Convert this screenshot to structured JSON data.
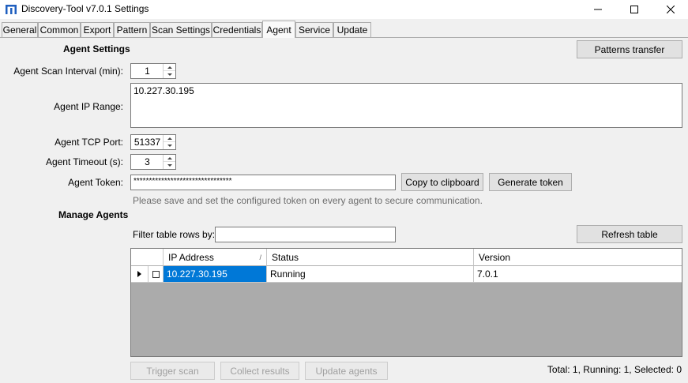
{
  "window": {
    "title": "Discovery-Tool v7.0.1 Settings",
    "minimize_glyph": "—",
    "maximize_glyph": "☐",
    "close_glyph": "✕"
  },
  "tabs": [
    {
      "label": "General"
    },
    {
      "label": "Common"
    },
    {
      "label": "Export"
    },
    {
      "label": "Pattern"
    },
    {
      "label": "Scan Settings"
    },
    {
      "label": "Credentials"
    },
    {
      "label": "Agent",
      "active": true
    },
    {
      "label": "Service"
    },
    {
      "label": "Update"
    }
  ],
  "agent_settings": {
    "heading": "Agent Settings",
    "patterns_transfer_button": "Patterns transfer",
    "scan_interval": {
      "label": "Agent Scan Interval (min):",
      "value": "1"
    },
    "ip_range": {
      "label": "Agent IP Range:",
      "value": "10.227.30.195"
    },
    "tcp_port": {
      "label": "Agent TCP Port:",
      "value": "51337"
    },
    "timeout": {
      "label": "Agent Timeout (s):",
      "value": "3"
    },
    "token": {
      "label": "Agent Token:",
      "value": "********************************",
      "copy_button": "Copy to clipboard",
      "generate_button": "Generate token",
      "note": "Please save and set the configured token on every agent to secure communication."
    }
  },
  "manage_agents": {
    "heading": "Manage Agents",
    "filter_label": "Filter table rows by:",
    "filter_value": "",
    "refresh_button": "Refresh table",
    "table": {
      "columns": [
        "IP Address",
        "Status",
        "Version"
      ],
      "sort_glyph": "/",
      "rows": [
        {
          "ip": "10.227.30.195",
          "status": "Running",
          "version": "7.0.1"
        }
      ]
    },
    "trigger_button": "Trigger scan",
    "collect_button": "Collect results",
    "update_button": "Update agents",
    "status_summary": "Total: 1, Running: 1, Selected: 0"
  },
  "colors": {
    "selection": "#0078d7",
    "app_icon": "#1f5fbf",
    "grid_empty": "#ababab"
  }
}
